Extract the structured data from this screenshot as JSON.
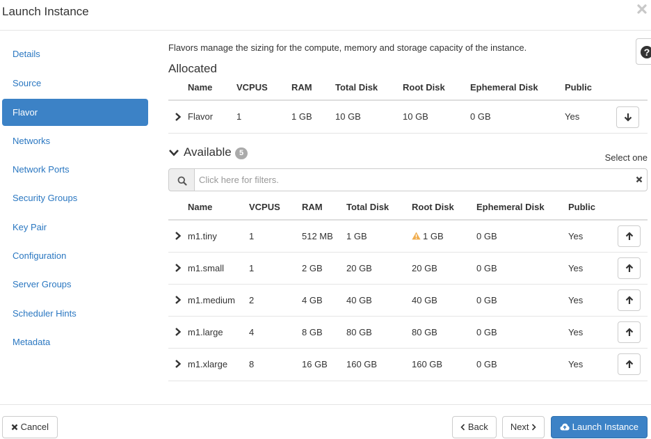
{
  "dialog": {
    "title": "Launch Instance"
  },
  "sidebar": {
    "items": [
      {
        "label": "Details"
      },
      {
        "label": "Source"
      },
      {
        "label": "Flavor",
        "active": true
      },
      {
        "label": "Networks"
      },
      {
        "label": "Network Ports"
      },
      {
        "label": "Security Groups"
      },
      {
        "label": "Key Pair"
      },
      {
        "label": "Configuration"
      },
      {
        "label": "Server Groups"
      },
      {
        "label": "Scheduler Hints"
      },
      {
        "label": "Metadata"
      }
    ]
  },
  "main": {
    "intro": "Flavors manage the sizing for the compute, memory and storage capacity of the instance.",
    "allocated": {
      "heading": "Allocated",
      "columns": [
        "Name",
        "VCPUS",
        "RAM",
        "Total Disk",
        "Root Disk",
        "Ephemeral Disk",
        "Public"
      ],
      "rows": [
        {
          "name": "Flavor",
          "vcpus": "1",
          "ram": "1 GB",
          "total_disk": "10 GB",
          "root_disk": "10 GB",
          "ephemeral_disk": "0 GB",
          "public": "Yes"
        }
      ]
    },
    "available": {
      "heading": "Available",
      "count": "5",
      "select_hint": "Select one",
      "search_placeholder": "Click here for filters.",
      "columns": [
        "Name",
        "VCPUS",
        "RAM",
        "Total Disk",
        "Root Disk",
        "Ephemeral Disk",
        "Public"
      ],
      "rows": [
        {
          "name": "m1.tiny",
          "vcpus": "1",
          "ram": "512 MB",
          "total_disk": "1 GB",
          "root_disk": "1 GB",
          "root_disk_warning": true,
          "ephemeral_disk": "0 GB",
          "public": "Yes"
        },
        {
          "name": "m1.small",
          "vcpus": "1",
          "ram": "2 GB",
          "total_disk": "20 GB",
          "root_disk": "20 GB",
          "ephemeral_disk": "0 GB",
          "public": "Yes"
        },
        {
          "name": "m1.medium",
          "vcpus": "2",
          "ram": "4 GB",
          "total_disk": "40 GB",
          "root_disk": "40 GB",
          "ephemeral_disk": "0 GB",
          "public": "Yes"
        },
        {
          "name": "m1.large",
          "vcpus": "4",
          "ram": "8 GB",
          "total_disk": "80 GB",
          "root_disk": "80 GB",
          "ephemeral_disk": "0 GB",
          "public": "Yes"
        },
        {
          "name": "m1.xlarge",
          "vcpus": "8",
          "ram": "16 GB",
          "total_disk": "160 GB",
          "root_disk": "160 GB",
          "ephemeral_disk": "0 GB",
          "public": "Yes"
        }
      ]
    }
  },
  "footer": {
    "cancel_label": "Cancel",
    "back_label": "Back",
    "next_label": "Next",
    "launch_label": "Launch Instance"
  },
  "colors": {
    "primary": "#3c82c6",
    "link": "#2a77c1",
    "warning": "#f0ad4e",
    "badge": "#aaaaaa"
  },
  "icons": {
    "close": "close-icon",
    "help": "question-circle-icon",
    "expand_row": "chevron-right-icon",
    "section_toggle": "chevron-down-icon",
    "deallocate": "arrow-down-icon",
    "allocate": "arrow-up-icon",
    "search": "search-icon",
    "clear_filter": "clear-icon",
    "warning": "warning-icon",
    "cancel": "times-icon",
    "back": "chevron-left-icon",
    "next": "chevron-right-icon",
    "launch": "cloud-upload-icon"
  }
}
